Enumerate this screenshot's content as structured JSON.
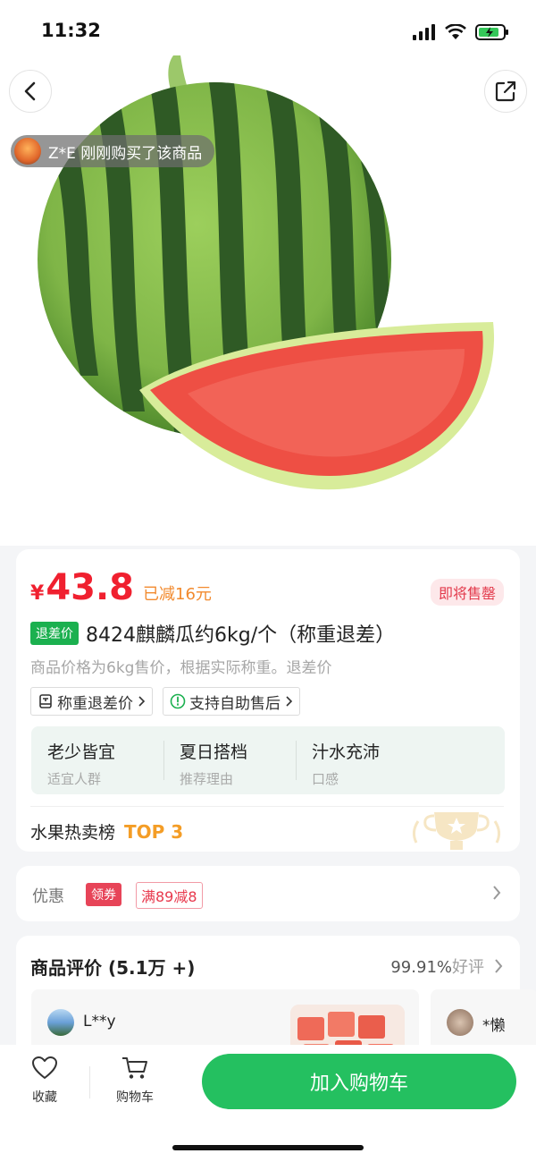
{
  "status_bar": {
    "time": "11:32"
  },
  "hero": {
    "buyer_tip": "Z*E 刚刚购买了该商品",
    "image_icon": "watermelon-image"
  },
  "product": {
    "price_symbol": "¥",
    "price": "43.8",
    "discount": "已减16元",
    "stock_badge": "即将售罄",
    "title_tag": "退差价",
    "title": "8424麒麟瓜约6kg/个（称重退差）",
    "subtitle": "商品价格为6kg售价，根据实际称重。退差价",
    "chips": [
      {
        "label": "称重退差价",
        "icon": "scale-icon"
      },
      {
        "label": "支持自助售后",
        "icon": "service-icon"
      }
    ],
    "features": [
      {
        "title": "老少皆宜",
        "sub": "适宜人群"
      },
      {
        "title": "夏日搭档",
        "sub": "推荐理由"
      },
      {
        "title": "汁水充沛",
        "sub": "口感"
      }
    ],
    "rank_label": "水果热卖榜",
    "rank_value": "TOP 3"
  },
  "promo": {
    "label": "优惠",
    "coupon_tag": "领券",
    "coupon_value": "满89减8"
  },
  "reviews": {
    "title": "商品评价 (5.1万 +)",
    "rate_value": "99.91%",
    "rate_label": "好评",
    "items": [
      {
        "user": "L**y"
      },
      {
        "user": "*懒"
      }
    ]
  },
  "bottom_bar": {
    "favorite": "收藏",
    "cart": "购物车",
    "add_to_cart": "加入购物车"
  },
  "colors": {
    "accent_green": "#24c060",
    "price_red": "#f0202f",
    "rank_orange": "#f49d26"
  }
}
